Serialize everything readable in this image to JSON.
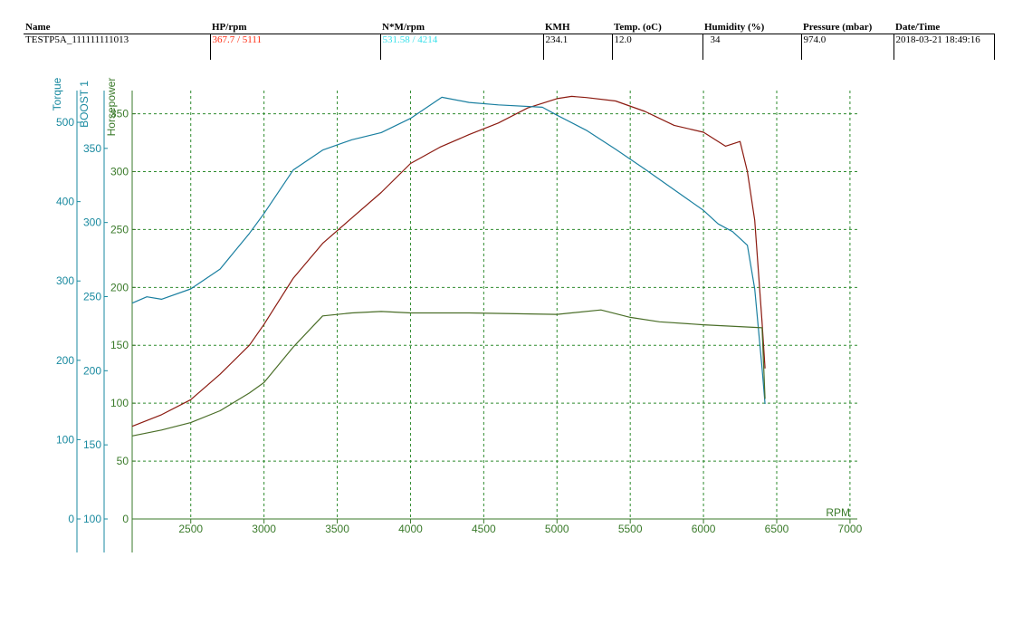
{
  "header": {
    "columns": [
      {
        "label": "Name",
        "value": "TESTP5A_111111111013"
      },
      {
        "label": "HP/rpm",
        "value": "367.7 / 5111"
      },
      {
        "label": "N*M/rpm",
        "value": "531.58 / 4214"
      },
      {
        "label": "KMH",
        "value": "234.1"
      },
      {
        "label": "Temp. (oC)",
        "value": "12.0"
      },
      {
        "label": "Humidity (%)",
        "value": "34"
      },
      {
        "label": "Pressure (mbar)",
        "value": "974.0"
      },
      {
        "label": "Date/Time",
        "value": "2018-03-21 18:49:16"
      }
    ]
  },
  "colors": {
    "hp_value": "#ff2a10",
    "nm_value": "#39e0ea",
    "grid": "#2e8b2e",
    "axis_green": "#3a7a2a",
    "axis_teal": "#1a8aa0",
    "horsepower_curve": "#8b1a10",
    "torque_curve": "#1a7fa0",
    "boost_curve": "#4a6e28"
  },
  "chart_data": {
    "type": "line",
    "xlabel": "RPM",
    "xlim": [
      2100,
      7050
    ],
    "xticks": [
      2500,
      3000,
      3500,
      4000,
      4500,
      5000,
      5500,
      6000,
      6500,
      7000
    ],
    "grid": true,
    "axes": [
      {
        "name": "Torque",
        "ticks": [
          0,
          100,
          200,
          300,
          400,
          500
        ],
        "range": [
          0,
          540
        ]
      },
      {
        "name": "BOOST 1",
        "ticks": [
          100,
          150,
          200,
          250,
          300,
          350
        ],
        "range": [
          100,
          389
        ]
      },
      {
        "name": "Horsepower",
        "ticks": [
          0,
          50,
          100,
          150,
          200,
          250,
          300,
          350
        ],
        "range": [
          0,
          370
        ]
      }
    ],
    "series": [
      {
        "name": "Horsepower",
        "axis": "Horsepower",
        "x": [
          2100,
          2300,
          2500,
          2700,
          2900,
          3000,
          3200,
          3400,
          3600,
          3800,
          4000,
          4200,
          4400,
          4600,
          4800,
          5000,
          5100,
          5200,
          5400,
          5600,
          5800,
          6000,
          6100,
          6150,
          6200,
          6250,
          6300,
          6350,
          6400,
          6420
        ],
        "y": [
          80,
          90,
          103,
          125,
          150,
          168,
          208,
          238,
          260,
          282,
          307,
          321,
          332,
          342,
          355,
          363,
          365,
          364,
          361,
          352,
          340,
          334,
          326,
          322,
          324,
          326,
          300,
          258,
          170,
          130
        ]
      },
      {
        "name": "Torque",
        "axis": "Torque",
        "x": [
          2100,
          2200,
          2300,
          2500,
          2700,
          2900,
          3000,
          3200,
          3400,
          3600,
          3800,
          4000,
          4214,
          4400,
          4600,
          4900,
          5000,
          5200,
          5400,
          5600,
          5800,
          6000,
          6100,
          6200,
          6300,
          6350,
          6400,
          6420
        ],
        "y": [
          272,
          280,
          277,
          290,
          315,
          360,
          385,
          440,
          465,
          478,
          487,
          505,
          531.58,
          525,
          522,
          519,
          509,
          490,
          466,
          441,
          415,
          389,
          372,
          362,
          345,
          290,
          190,
          145
        ]
      },
      {
        "name": "BOOST 1",
        "axis": "BOOST 1",
        "x": [
          2100,
          2300,
          2500,
          2700,
          2900,
          3000,
          3200,
          3400,
          3600,
          3800,
          4000,
          4400,
          5000,
          5300,
          5500,
          5700,
          6000,
          6400,
          6420
        ],
        "y": [
          156,
          160,
          165,
          173,
          185,
          192,
          216,
          237,
          239,
          240,
          239,
          239,
          238,
          241,
          236,
          233,
          231,
          229,
          181
        ]
      }
    ]
  }
}
